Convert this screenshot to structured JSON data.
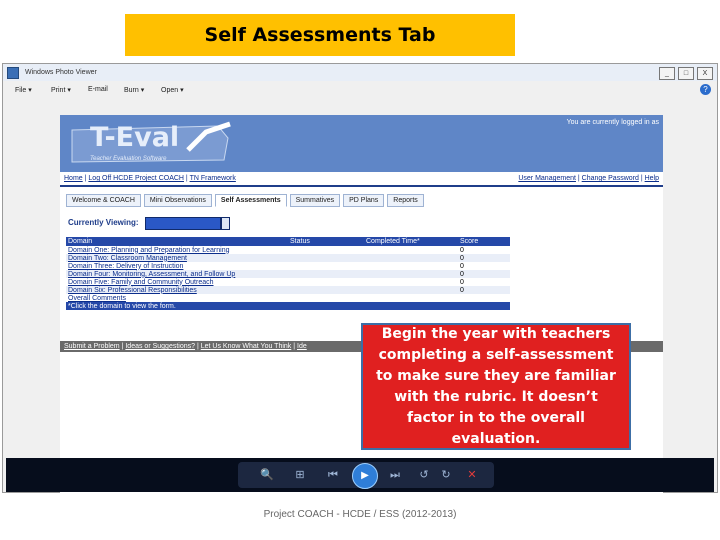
{
  "slide": {
    "title": "Self Assessments Tab",
    "callout": "Begin the year with teachers completing a self-assessment to make sure they are familiar with the rubric.  It doesn’t factor in to the overall evaluation.",
    "footer": "Project COACH - HCDE / ESS (2012-2013)"
  },
  "viewer": {
    "title": "Windows Photo Viewer",
    "window_buttons": [
      "_",
      "□",
      "X"
    ],
    "menu": [
      {
        "label": "File",
        "icon": "chevron-down-icon"
      },
      {
        "label": "Print",
        "icon": "chevron-down-icon"
      },
      {
        "label": "E-mail",
        "icon": "chevron-down-icon"
      },
      {
        "label": "Burn",
        "icon": "chevron-down-icon"
      },
      {
        "label": "Open",
        "icon": "chevron-down-icon"
      }
    ],
    "help_label": "?"
  },
  "app": {
    "logo_text": "T-Eval",
    "logo_subtitle": "Teacher Evaluation Software",
    "logged_in_text": "You are currently logged in as",
    "nav_left": [
      "Home",
      "Log Off HCDE Project COACH",
      "TN Framework"
    ],
    "nav_right": [
      "User Management",
      "Change Password",
      "Help"
    ],
    "tabs": [
      "Welcome & COACH",
      "Mini Observations",
      "Self Assessments",
      "Summatives",
      "PD Plans",
      "Reports"
    ],
    "active_tab_index": 2,
    "currently_viewing_label": "Currently Viewing:",
    "table": {
      "headers": [
        "Domain",
        "Status",
        "Completed Time*",
        "Score"
      ],
      "rows": [
        {
          "domain": "Domain One: Planning and Preparation for Learning",
          "status": "",
          "completed": "",
          "score": "0"
        },
        {
          "domain": "Domain Two: Classroom Management",
          "status": "",
          "completed": "",
          "score": "0"
        },
        {
          "domain": "Domain Three: Delivery of Instruction",
          "status": "",
          "completed": "",
          "score": "0"
        },
        {
          "domain": "Domain Four: Monitoring, Assessment, and Follow Up",
          "status": "",
          "completed": "",
          "score": "0"
        },
        {
          "domain": "Domain Five: Family and Community Outreach",
          "status": "",
          "completed": "",
          "score": "0"
        },
        {
          "domain": "Domain Six: Professional Responsibilities",
          "status": "",
          "completed": "",
          "score": "0"
        },
        {
          "domain": "Overall Comments",
          "status": "",
          "completed": "",
          "score": ""
        }
      ],
      "footnote": "*Click the domain to view the form."
    },
    "footer_links": [
      "Submit a Problem",
      "Ideas or Suggestions?",
      "Let Us Know What You Think",
      "Ide"
    ]
  },
  "controls": {
    "zoom": "🔍",
    "actual_size": "⊞",
    "previous": "⏮",
    "play": "▶",
    "next": "⏭",
    "rotate_left": "↺",
    "rotate_right": "↻",
    "delete": "✕"
  }
}
